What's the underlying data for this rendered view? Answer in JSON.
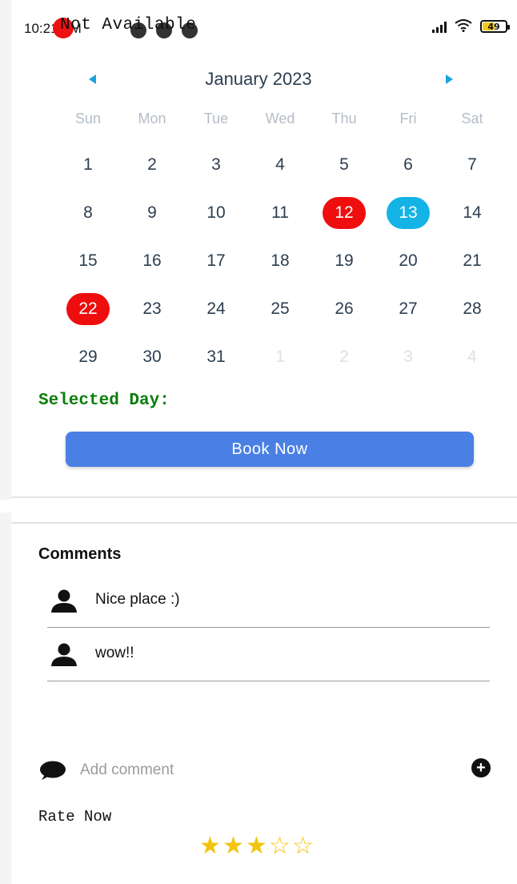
{
  "status_bar": {
    "time": "10:21 AM",
    "overlay_text": "Not Available",
    "battery": "49",
    "battery_fraction": 0.49,
    "icons": [
      "signal-icon",
      "wifi-icon",
      "battery-icon"
    ]
  },
  "calendar": {
    "month_title": "January 2023",
    "weekdays": [
      "Sun",
      "Mon",
      "Tue",
      "Wed",
      "Thu",
      "Fri",
      "Sat"
    ],
    "days": [
      {
        "label": "1",
        "state": "normal"
      },
      {
        "label": "2",
        "state": "normal"
      },
      {
        "label": "3",
        "state": "normal"
      },
      {
        "label": "4",
        "state": "normal"
      },
      {
        "label": "5",
        "state": "normal"
      },
      {
        "label": "6",
        "state": "normal"
      },
      {
        "label": "7",
        "state": "normal"
      },
      {
        "label": "8",
        "state": "normal"
      },
      {
        "label": "9",
        "state": "normal"
      },
      {
        "label": "10",
        "state": "normal"
      },
      {
        "label": "11",
        "state": "normal"
      },
      {
        "label": "12",
        "state": "unavailable"
      },
      {
        "label": "13",
        "state": "selected"
      },
      {
        "label": "14",
        "state": "normal"
      },
      {
        "label": "15",
        "state": "normal"
      },
      {
        "label": "16",
        "state": "normal"
      },
      {
        "label": "17",
        "state": "normal"
      },
      {
        "label": "18",
        "state": "normal"
      },
      {
        "label": "19",
        "state": "normal"
      },
      {
        "label": "20",
        "state": "normal"
      },
      {
        "label": "21",
        "state": "normal"
      },
      {
        "label": "22",
        "state": "unavailable"
      },
      {
        "label": "23",
        "state": "normal"
      },
      {
        "label": "24",
        "state": "normal"
      },
      {
        "label": "25",
        "state": "normal"
      },
      {
        "label": "26",
        "state": "normal"
      },
      {
        "label": "27",
        "state": "normal"
      },
      {
        "label": "28",
        "state": "normal"
      },
      {
        "label": "29",
        "state": "normal"
      },
      {
        "label": "30",
        "state": "normal"
      },
      {
        "label": "31",
        "state": "normal"
      },
      {
        "label": "1",
        "state": "muted"
      },
      {
        "label": "2",
        "state": "muted"
      },
      {
        "label": "3",
        "state": "muted"
      },
      {
        "label": "4",
        "state": "muted"
      }
    ],
    "colors": {
      "unavailable": "#ee0e0e",
      "selected": "#14b3e6",
      "arrow": "#1ba3e0"
    }
  },
  "booking": {
    "selected_day_label": "Selected Day:",
    "book_button_label": "Book Now",
    "button_color": "#4a80e4"
  },
  "comments": {
    "title": "Comments",
    "items": [
      {
        "text": "Nice place :)"
      },
      {
        "text": "wow!!"
      }
    ],
    "add_placeholder": "Add comment"
  },
  "rating": {
    "label": "Rate Now",
    "value": 3,
    "max": 5
  }
}
